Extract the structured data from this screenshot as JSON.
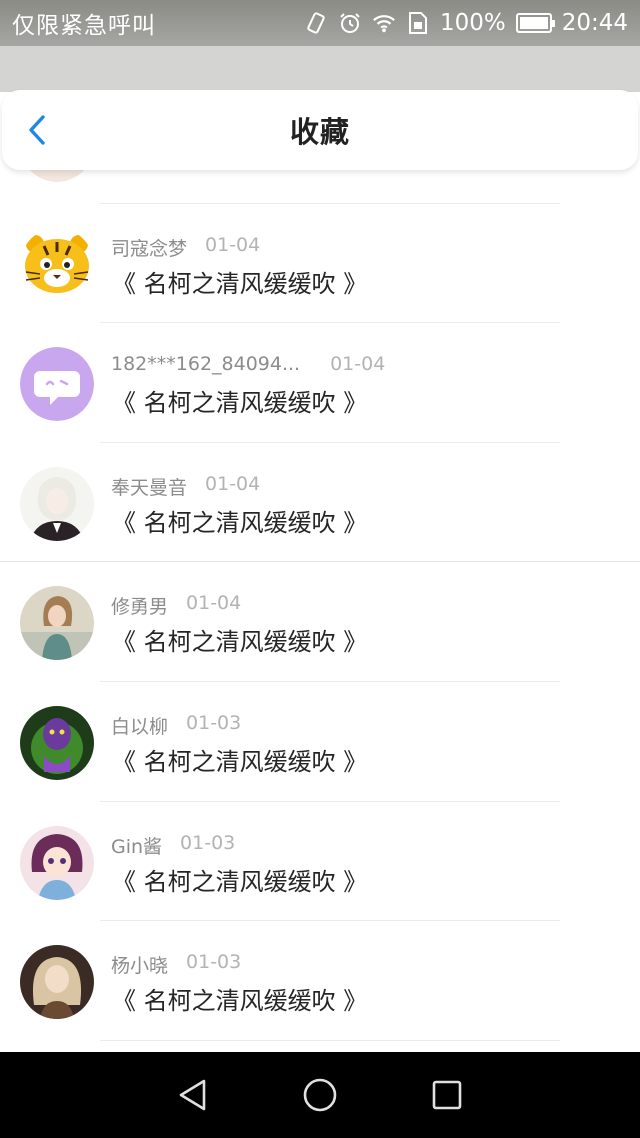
{
  "status_bar": {
    "carrier": "仅限紧急呼叫",
    "battery": "100%",
    "time": "20:44",
    "icons": [
      "vibrate-icon",
      "alarm-icon",
      "wifi-icon",
      "sim-icon",
      "battery-icon"
    ]
  },
  "header": {
    "title": "收藏",
    "back_icon": "chevron-left-icon",
    "accent_color": "#1e88e5"
  },
  "favorites": [
    {
      "user": "",
      "date": "",
      "title": ""
    },
    {
      "user": "司寇念梦",
      "date": "01-04",
      "title": "《 名柯之清风缓缓吹 》"
    },
    {
      "user": "182***162_84094...",
      "date": "01-04",
      "title": "《 名柯之清风缓缓吹 》"
    },
    {
      "user": "奉天曼音",
      "date": "01-04",
      "title": "《 名柯之清风缓缓吹 》"
    },
    {
      "user": "修勇男",
      "date": "01-04",
      "title": "《 名柯之清风缓缓吹 》"
    },
    {
      "user": "白以柳",
      "date": "01-03",
      "title": "《 名柯之清风缓缓吹 》"
    },
    {
      "user": "Gin酱",
      "date": "01-03",
      "title": "《 名柯之清风缓缓吹 》"
    },
    {
      "user": "杨小晓",
      "date": "01-03",
      "title": "《 名柯之清风缓缓吹 》"
    }
  ],
  "system_nav": {
    "icons": [
      "back-triangle-icon",
      "home-circle-icon",
      "recents-square-icon"
    ]
  }
}
